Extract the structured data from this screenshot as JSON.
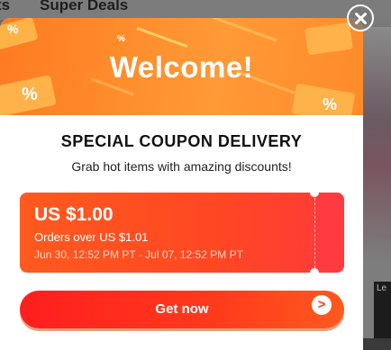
{
  "background": {
    "nav_left": "ts",
    "nav_item": "Super Deals",
    "thumb_label": "Le"
  },
  "modal": {
    "hero_title": "Welcome!",
    "title": "SPECIAL COUPON DELIVERY",
    "subtitle": "Grab hot items with amazing discounts!",
    "coupon": {
      "amount": "US $1.00",
      "condition": "Orders over US $1.01",
      "validity": "Jun 30, 12:52 PM PT - Jul 07, 12:52 PM PT"
    },
    "cta_label": "Get now",
    "cta_arrow": ">"
  },
  "colors": {
    "accent": "#ff3a1c",
    "hero": "#ff8d2c"
  },
  "icons": [
    "close-icon",
    "chevron-right-icon",
    "coupon-icon"
  ]
}
